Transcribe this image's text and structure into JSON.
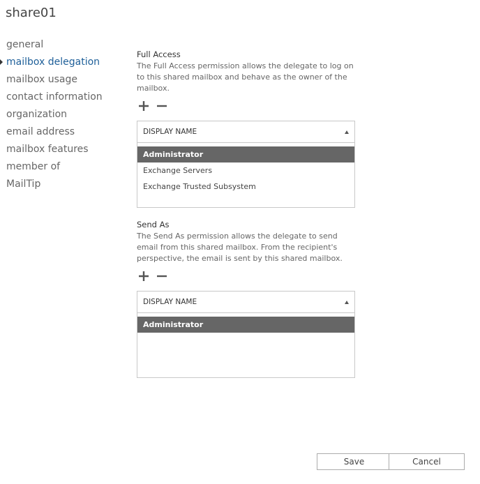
{
  "title": "share01",
  "nav": {
    "items": [
      {
        "label": "general"
      },
      {
        "label": "mailbox delegation",
        "active": true
      },
      {
        "label": "mailbox usage"
      },
      {
        "label": "contact information"
      },
      {
        "label": "organization"
      },
      {
        "label": "email address"
      },
      {
        "label": "mailbox features"
      },
      {
        "label": "member of"
      },
      {
        "label": "MailTip"
      }
    ]
  },
  "full_access": {
    "title": "Full Access",
    "description": "The Full Access permission allows the delegate to log on to this shared mailbox and behave as the owner of the mailbox.",
    "add_icon": "plus-icon",
    "remove_icon": "minus-icon",
    "column_header": "DISPLAY NAME",
    "rows": [
      {
        "name": "Administrator",
        "selected": true
      },
      {
        "name": "Exchange Servers"
      },
      {
        "name": "Exchange Trusted Subsystem"
      }
    ]
  },
  "send_as": {
    "title": "Send As",
    "description": "The Send As permission allows the delegate to send email from this shared mailbox. From the recipient's perspective, the email is sent by this shared mailbox.",
    "add_icon": "plus-icon",
    "remove_icon": "minus-icon",
    "column_header": "DISPLAY NAME",
    "rows": [
      {
        "name": "Administrator",
        "selected": true
      }
    ]
  },
  "buttons": {
    "save": "Save",
    "cancel": "Cancel"
  },
  "colors": {
    "nav_active": "#1e5f99",
    "selected_row_bg": "#666666",
    "border": "#c8c8c8"
  }
}
